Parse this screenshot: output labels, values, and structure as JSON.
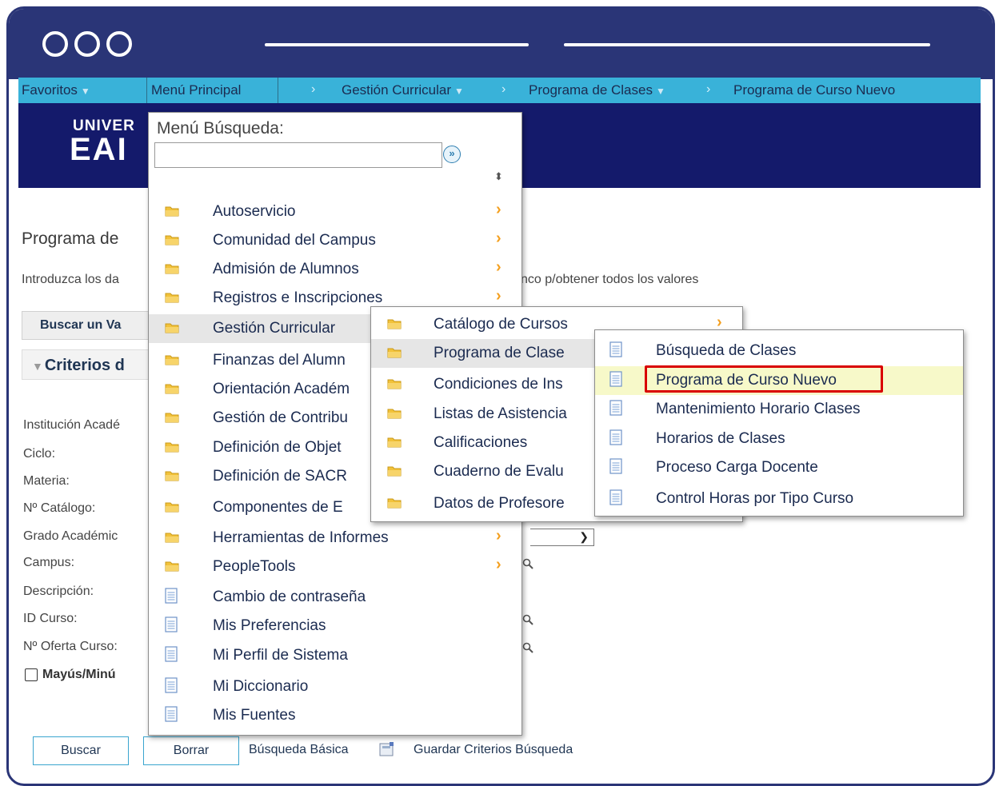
{
  "navbar": {
    "favoritos": "Favoritos",
    "menu_principal": "Menú Principal",
    "gestion_curricular": "Gestión Curricular",
    "programa_clases": "Programa de Clases",
    "programa_curso_nuevo": "Programa de Curso Nuevo"
  },
  "page": {
    "title": "Programa de",
    "instructions": "Introduzca los da",
    "instructions_right": "nco p/obtener todos los valores",
    "tab_buscar": "Buscar un Va",
    "criteria": "Criterios d",
    "fields": [
      "Institución Acadé",
      "Ciclo:",
      "Materia:",
      "Nº Catálogo:",
      "Grado Académic",
      "Campus:",
      "Descripción:",
      "ID Curso:",
      "Nº Oferta Curso:"
    ],
    "checkbox_label": "Mayús/Minú",
    "buttons": {
      "buscar": "Buscar",
      "borrar": "Borrar"
    },
    "links": {
      "busqueda_basica": "Búsqueda Básica",
      "guardar": "Guardar Criterios Búsqueda"
    }
  },
  "menu_main": {
    "search_label": "Menú Búsqueda:",
    "search_value": "",
    "go_label": "»",
    "items": [
      {
        "label": "Autoservicio",
        "type": "folder",
        "arrow": true
      },
      {
        "label": "Comunidad del Campus",
        "type": "folder",
        "arrow": true
      },
      {
        "label": "Admisión de Alumnos",
        "type": "folder",
        "arrow": true
      },
      {
        "label": "Registros e Inscripciones",
        "type": "folder",
        "arrow": true
      },
      {
        "label": "Gestión Curricular",
        "type": "folder",
        "arrow": false
      },
      {
        "label": "Finanzas del Alumn",
        "type": "folder",
        "arrow": false
      },
      {
        "label": "Orientación Académ",
        "type": "folder",
        "arrow": false
      },
      {
        "label": "Gestión de Contribu",
        "type": "folder",
        "arrow": false
      },
      {
        "label": "Definición de Objet",
        "type": "folder",
        "arrow": false
      },
      {
        "label": "Definición de SACR",
        "type": "folder",
        "arrow": false
      },
      {
        "label": "Componentes de E",
        "type": "folder",
        "arrow": false
      },
      {
        "label": "Herramientas de Informes",
        "type": "folder",
        "arrow": true
      },
      {
        "label": "PeopleTools",
        "type": "folder",
        "arrow": true
      },
      {
        "label": "Cambio de contraseña",
        "type": "doc",
        "arrow": false
      },
      {
        "label": "Mis Preferencias",
        "type": "doc",
        "arrow": false
      },
      {
        "label": "Mi Perfil de Sistema",
        "type": "doc",
        "arrow": false
      },
      {
        "label": "Mi Diccionario",
        "type": "doc",
        "arrow": false
      },
      {
        "label": "Mis Fuentes",
        "type": "doc",
        "arrow": false
      }
    ]
  },
  "menu_gestion": {
    "items": [
      {
        "label": "Catálogo de Cursos",
        "arrow": true
      },
      {
        "label": "Programa de Clase",
        "arrow": false
      },
      {
        "label": "Condiciones de Ins",
        "arrow": false
      },
      {
        "label": "Listas de Asistencia",
        "arrow": false
      },
      {
        "label": "Calificaciones",
        "arrow": false
      },
      {
        "label": "Cuaderno de Evalu",
        "arrow": false
      },
      {
        "label": "Datos de Profesore",
        "arrow": false
      }
    ]
  },
  "menu_programa": {
    "items": [
      {
        "label": "Búsqueda de Clases"
      },
      {
        "label": "Programa de Curso Nuevo"
      },
      {
        "label": "Mantenimiento Horario Clases"
      },
      {
        "label": "Horarios de Clases"
      },
      {
        "label": "Proceso Carga Docente"
      },
      {
        "label": "Control Horas por Tipo Curso"
      }
    ]
  },
  "colors": {
    "frame": "#2a3577",
    "navbar": "#39b2d9",
    "banner": "#141a6b",
    "folder": "#f2c23a",
    "arrow": "#f4a020",
    "highlight_box": "#d90000"
  }
}
